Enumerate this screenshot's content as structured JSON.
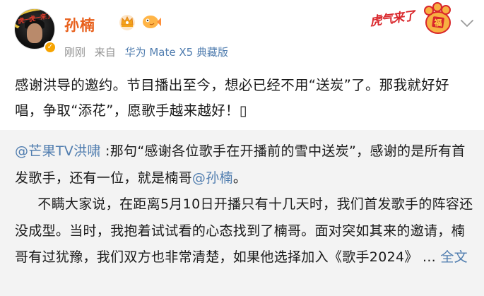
{
  "user": {
    "name": "孙楠",
    "avatar_sticker_text": "虎一虎一来了",
    "meta_time": "刚刚",
    "meta_from": "来自",
    "meta_device": "华为 Mate X5 典藏版"
  },
  "sticker": {
    "text": "虎气来了",
    "paw_text": "福"
  },
  "post": {
    "text": "感谢洪导的邀约。节目播出至今，想必已经不用“送炭”了。那我就好好唱，争取“添花”，愿歌手越来越好！▯"
  },
  "repost": {
    "author_mention": "@芒果TV洪啸",
    "text1": " :那句“感谢各位歌手在开播前的雪中送炭”，感谢的是所有首发歌手，还有一位，就是楠哥",
    "mention": "@孙楠",
    "text1_end": "。",
    "text2": "不瞒大家说，在距离5月10日开播只有十几天时，我们首发歌手的阵容还没成型。当时，我抱着试试看的心态找到了楠哥。面对突如其来的邀请，楠哥有过犹豫，我们双方也非常清楚，如果他选择加入《歌手2024》 ... ",
    "more_label": "全文"
  },
  "colors": {
    "name": "#e8601c",
    "link": "#507daf",
    "repost_bg": "#f3f3f3",
    "meta": "#939393"
  }
}
